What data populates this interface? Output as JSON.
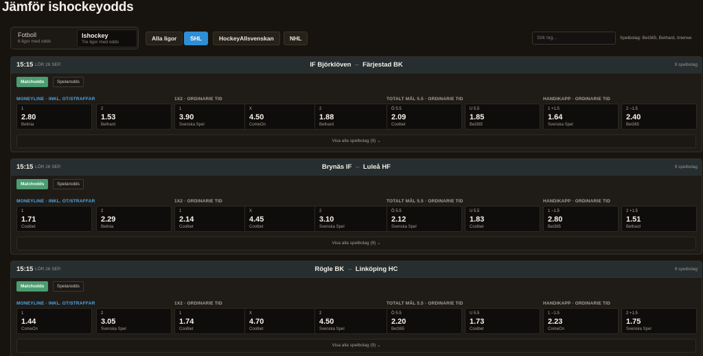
{
  "page_title": "Jämför ishockeyodds",
  "sports": [
    {
      "name": "Fotboll",
      "sub": "6 ligor med odds"
    },
    {
      "name": "Ishockey",
      "sub": "Tre ligor med odds"
    }
  ],
  "leagues": [
    "Alla ligor",
    "SHL",
    "HockeyAllsvenskan",
    "NHL"
  ],
  "active_league": "SHL",
  "search": {
    "placeholder": "Sök lag..."
  },
  "spelbolag_info": "Spelbolag: Bet365, Bethard, Interwe",
  "colors": {
    "accent": "#2f8fd6",
    "tab_active": "#4c9c72",
    "moneyline": "#4fa8e8"
  },
  "market_labels": [
    "MONEYLINE · INKL. OT/STRAFFAR",
    "1X2 · ORDINARIE TID",
    "TOTALT MÅL 5.5 · ORDINARIE TID",
    "HANDIKAPP · ORDINARIE TID"
  ],
  "tabs": [
    "Matchodds",
    "Spelarodds"
  ],
  "matches": [
    {
      "time": "15:15",
      "date": "LÖR 26 SEP.",
      "home": "IF Björklöven",
      "away": "Färjestad BK",
      "sep": "–",
      "books": "9 spelbolag",
      "show_all": "Visa alla spelbolag (9)  ⌄",
      "odds": [
        {
          "label": "1",
          "value": "2.80",
          "book": "Betinia"
        },
        {
          "label": "2",
          "value": "1.53",
          "book": "Bethard"
        },
        {
          "label": "1",
          "value": "3.90",
          "book": "Svenska Spel"
        },
        {
          "label": "X",
          "value": "4.50",
          "book": "ComeOn"
        },
        {
          "label": "2",
          "value": "1.88",
          "book": "Bethard"
        },
        {
          "label": "Ö 5.5",
          "value": "2.09",
          "book": "Coolbet"
        },
        {
          "label": "U 5.5",
          "value": "1.85",
          "book": "Bet365"
        },
        {
          "label": "1 +1.5",
          "value": "1.64",
          "book": "Svenska Spel"
        },
        {
          "label": "2 −1.5",
          "value": "2.40",
          "book": "Bet365"
        }
      ]
    },
    {
      "time": "15:15",
      "date": "LÖR 26 SEP.",
      "home": "Brynäs IF",
      "away": "Luleå HF",
      "sep": "–",
      "books": "9 spelbolag",
      "show_all": "Visa alla spelbolag (9)  ⌄",
      "odds": [
        {
          "label": "1",
          "value": "1.71",
          "book": "Coolbet"
        },
        {
          "label": "2",
          "value": "2.29",
          "book": "Betinia"
        },
        {
          "label": "1",
          "value": "2.14",
          "book": "Coolbet"
        },
        {
          "label": "X",
          "value": "4.45",
          "book": "Coolbet"
        },
        {
          "label": "2",
          "value": "3.10",
          "book": "Svenska Spel"
        },
        {
          "label": "Ö 5.5",
          "value": "2.12",
          "book": "Svenska Spel"
        },
        {
          "label": "U 5.5",
          "value": "1.83",
          "book": "Coolbet"
        },
        {
          "label": "1 −1.5",
          "value": "2.80",
          "book": "Bet365"
        },
        {
          "label": "2 +1.5",
          "value": "1.51",
          "book": "Bethard"
        }
      ]
    },
    {
      "time": "15:15",
      "date": "LÖR 26 SEP.",
      "home": "Rögle BK",
      "away": "Linköping HC",
      "sep": "–",
      "books": "9 spelbolag",
      "show_all": "Visa alla spelbolag (9)  ⌄",
      "odds": [
        {
          "label": "1",
          "value": "1.44",
          "book": "ComeOn"
        },
        {
          "label": "2",
          "value": "3.05",
          "book": "Svenska Spel"
        },
        {
          "label": "1",
          "value": "1.74",
          "book": "Coolbet"
        },
        {
          "label": "X",
          "value": "4.70",
          "book": "Coolbet"
        },
        {
          "label": "2",
          "value": "4.50",
          "book": "Svenska Spel"
        },
        {
          "label": "Ö 5.5",
          "value": "2.20",
          "book": "Bet365"
        },
        {
          "label": "U 5.5",
          "value": "1.73",
          "book": "Coolbet"
        },
        {
          "label": "1 −1.5",
          "value": "2.23",
          "book": "ComeOn"
        },
        {
          "label": "2 +1.5",
          "value": "1.75",
          "book": "Svenska Spel"
        }
      ]
    }
  ]
}
